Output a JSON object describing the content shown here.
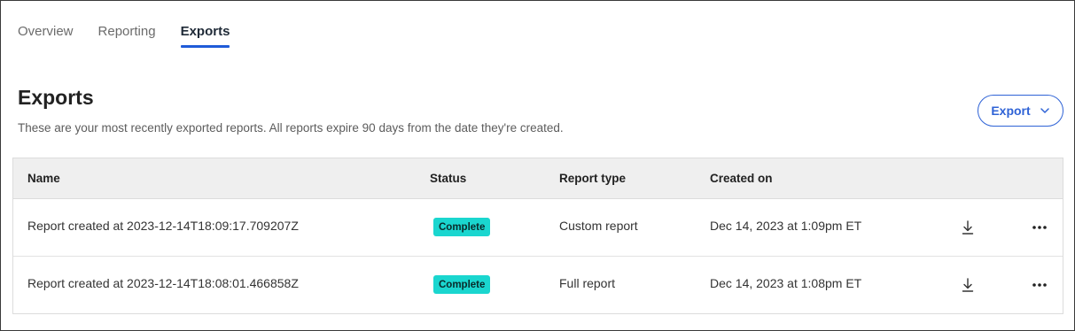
{
  "tabs": [
    {
      "label": "Overview",
      "active": false
    },
    {
      "label": "Reporting",
      "active": false
    },
    {
      "label": "Exports",
      "active": true
    }
  ],
  "header": {
    "title": "Exports",
    "description": "These are your most recently exported reports. All reports expire 90 days from the date they're created.",
    "export_button": "Export"
  },
  "table": {
    "columns": [
      "Name",
      "Status",
      "Report type",
      "Created on"
    ],
    "rows": [
      {
        "name": "Report created at 2023-12-14T18:09:17.709207Z",
        "status": "Complete",
        "report_type": "Custom report",
        "created_on": "Dec 14, 2023 at 1:09pm ET"
      },
      {
        "name": "Report created at 2023-12-14T18:08:01.466858Z",
        "status": "Complete",
        "report_type": "Full report",
        "created_on": "Dec 14, 2023 at 1:08pm ET"
      }
    ]
  },
  "icons": {
    "export_chevron": "chevron-down-icon",
    "download": "download-icon",
    "more": "more-horizontal-icon"
  },
  "colors": {
    "accent": "#2f63d6",
    "status_complete": "#1ad6cf",
    "header_bg": "#efefef"
  }
}
